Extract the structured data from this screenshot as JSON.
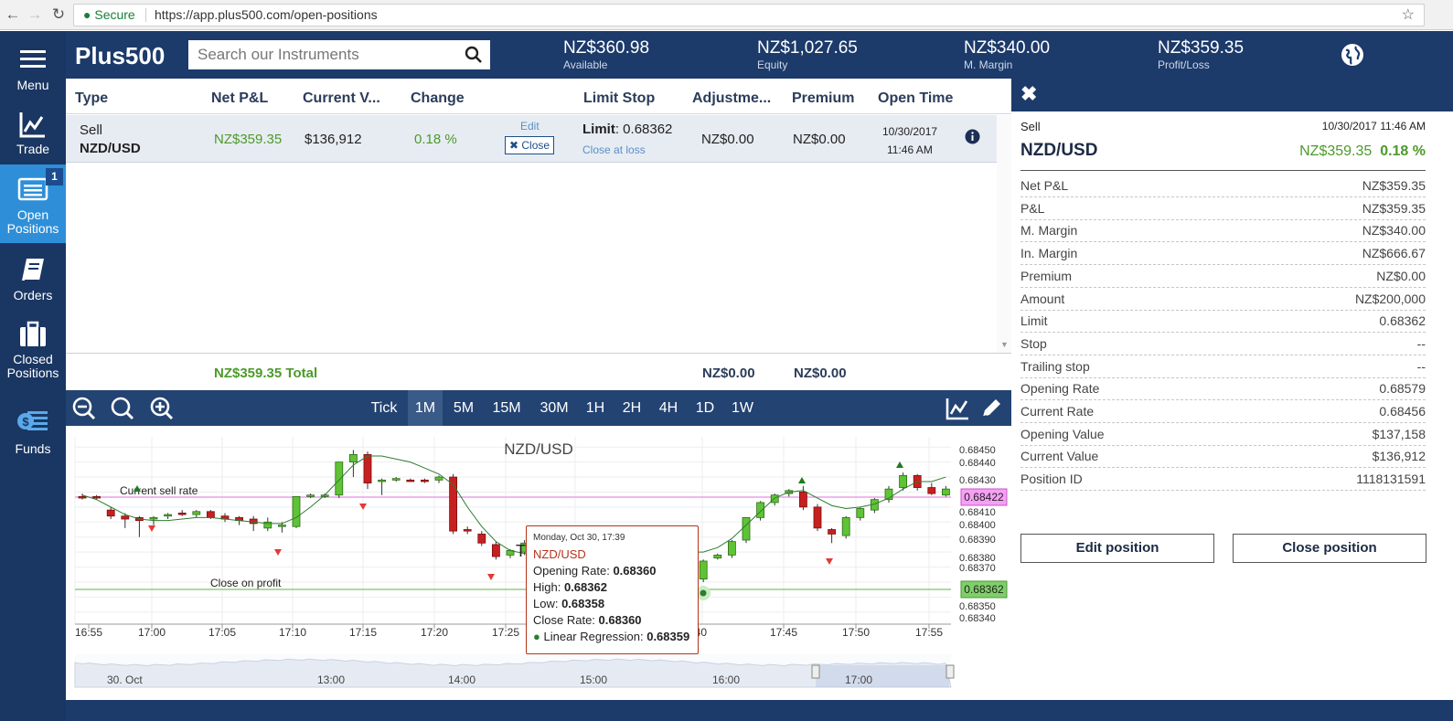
{
  "browser": {
    "secure_label": "Secure",
    "url": "https://app.plus500.com/open-positions"
  },
  "nav": {
    "menu": "Menu",
    "trade": "Trade",
    "open_positions": "Open\nPositions",
    "open_badge": "1",
    "orders": "Orders",
    "closed_positions": "Closed\nPositions",
    "funds": "Funds"
  },
  "header": {
    "logo": "Plus500",
    "search_placeholder": "Search our Instruments",
    "stats": [
      {
        "value": "NZ$360.98",
        "label": "Available"
      },
      {
        "value": "NZ$1,027.65",
        "label": "Equity"
      },
      {
        "value": "NZ$340.00",
        "label": "M. Margin"
      },
      {
        "value": "NZ$359.35",
        "label": "Profit/Loss"
      }
    ]
  },
  "table": {
    "columns": [
      "Type",
      "Net P&L",
      "Current V...",
      "Change",
      "Limit Stop",
      "Adjustme...",
      "Premium",
      "Open Time"
    ],
    "row": {
      "type": "Sell",
      "instrument": "NZD/USD",
      "net_pl": "NZ$359.35",
      "current_value": "$136,912",
      "change": "0.18 %",
      "edit": "Edit",
      "close": "Close",
      "limit_label": "Limit",
      "limit_value": ": 0.68362",
      "close_at_loss": "Close at loss",
      "adjustment": "NZ$0.00",
      "premium": "NZ$0.00",
      "open_date": "10/30/2017",
      "open_time": "11:46 AM"
    },
    "totals": {
      "net_pl": "NZ$359.35",
      "total_label": "Total",
      "adjustment": "NZ$0.00",
      "premium": "NZ$0.00"
    }
  },
  "chart_toolbar": {
    "timeframes": [
      "Tick",
      "1M",
      "5M",
      "15M",
      "30M",
      "1H",
      "2H",
      "4H",
      "1D",
      "1W"
    ],
    "selected": "1M"
  },
  "chart_data": {
    "type": "candlestick",
    "title": "NZD/USD",
    "x_ticks": [
      "16:55",
      "17:00",
      "17:05",
      "17:10",
      "17:15",
      "17:20",
      "17:25",
      "17:40",
      "17:45",
      "17:50",
      "17:55"
    ],
    "y_ticks": [
      "0.68450",
      "0.68440",
      "0.68430",
      "0.68410",
      "0.68400",
      "0.68390",
      "0.68380",
      "0.68370",
      "0.68350",
      "0.68340"
    ],
    "ylim": [
      0.68335,
      0.68455
    ],
    "annotations": {
      "current_sell_rate_label": "Current sell rate",
      "current_sell_rate": "0.68422",
      "close_on_profit_label": "Close on profit",
      "close_on_profit": "0.68362",
      "cursor_label": "T"
    },
    "series": [
      {
        "o": 0.68417,
        "h": 0.68419,
        "l": 0.68415,
        "c": 0.68416
      },
      {
        "o": 0.68417,
        "h": 0.68418,
        "l": 0.68415,
        "c": 0.68416
      },
      {
        "o": 0.68408,
        "h": 0.6841,
        "l": 0.68402,
        "c": 0.68404
      },
      {
        "o": 0.68404,
        "h": 0.68406,
        "l": 0.68396,
        "c": 0.68402
      },
      {
        "o": 0.68403,
        "h": 0.68404,
        "l": 0.6839,
        "c": 0.68401
      },
      {
        "o": 0.68402,
        "h": 0.68404,
        "l": 0.68398,
        "c": 0.68403
      },
      {
        "o": 0.68404,
        "h": 0.68406,
        "l": 0.68402,
        "c": 0.68405
      },
      {
        "o": 0.68406,
        "h": 0.68408,
        "l": 0.68404,
        "c": 0.68405
      },
      {
        "o": 0.68405,
        "h": 0.68408,
        "l": 0.68403,
        "c": 0.68407
      },
      {
        "o": 0.68407,
        "h": 0.68408,
        "l": 0.68402,
        "c": 0.68403
      },
      {
        "o": 0.68404,
        "h": 0.68406,
        "l": 0.684,
        "c": 0.68402
      },
      {
        "o": 0.68403,
        "h": 0.68404,
        "l": 0.68398,
        "c": 0.68401
      },
      {
        "o": 0.68402,
        "h": 0.68404,
        "l": 0.68394,
        "c": 0.68399
      },
      {
        "o": 0.68396,
        "h": 0.68403,
        "l": 0.68394,
        "c": 0.684
      },
      {
        "o": 0.68397,
        "h": 0.684,
        "l": 0.68393,
        "c": 0.68398
      },
      {
        "o": 0.68397,
        "h": 0.68417,
        "l": 0.68396,
        "c": 0.68417
      },
      {
        "o": 0.68417,
        "h": 0.68419,
        "l": 0.68416,
        "c": 0.68418
      },
      {
        "o": 0.68417,
        "h": 0.68419,
        "l": 0.68416,
        "c": 0.68418
      },
      {
        "o": 0.68418,
        "h": 0.6844,
        "l": 0.68416,
        "c": 0.6844
      },
      {
        "o": 0.6844,
        "h": 0.68448,
        "l": 0.6843,
        "c": 0.68445
      },
      {
        "o": 0.68445,
        "h": 0.68447,
        "l": 0.68422,
        "c": 0.68426
      },
      {
        "o": 0.68427,
        "h": 0.68429,
        "l": 0.68418,
        "c": 0.68428
      },
      {
        "o": 0.68428,
        "h": 0.6843,
        "l": 0.68427,
        "c": 0.68429
      },
      {
        "o": 0.68428,
        "h": 0.68429,
        "l": 0.68427,
        "c": 0.68427
      },
      {
        "o": 0.68428,
        "h": 0.68429,
        "l": 0.68426,
        "c": 0.68427
      },
      {
        "o": 0.68428,
        "h": 0.68431,
        "l": 0.68426,
        "c": 0.6843
      },
      {
        "o": 0.6843,
        "h": 0.68432,
        "l": 0.68392,
        "c": 0.68394
      },
      {
        "o": 0.68395,
        "h": 0.68397,
        "l": 0.68392,
        "c": 0.68394
      },
      {
        "o": 0.68392,
        "h": 0.68394,
        "l": 0.68384,
        "c": 0.68386
      },
      {
        "o": 0.68385,
        "h": 0.68387,
        "l": 0.68375,
        "c": 0.68377
      },
      {
        "o": 0.68378,
        "h": 0.68382,
        "l": 0.68376,
        "c": 0.68381
      },
      {
        "o": 0.6838,
        "h": 0.68388,
        "l": 0.68378,
        "c": 0.68386
      },
      {
        "o": 0.68362,
        "h": 0.68375,
        "l": 0.6836,
        "c": 0.68374
      },
      {
        "o": 0.68376,
        "h": 0.68379,
        "l": 0.68375,
        "c": 0.68378
      },
      {
        "o": 0.68378,
        "h": 0.68388,
        "l": 0.68376,
        "c": 0.68387
      },
      {
        "o": 0.68388,
        "h": 0.68403,
        "l": 0.68386,
        "c": 0.68403
      },
      {
        "o": 0.68403,
        "h": 0.68414,
        "l": 0.68401,
        "c": 0.68413
      },
      {
        "o": 0.68413,
        "h": 0.68419,
        "l": 0.68411,
        "c": 0.68418
      },
      {
        "o": 0.68419,
        "h": 0.68422,
        "l": 0.68417,
        "c": 0.68421
      },
      {
        "o": 0.6842,
        "h": 0.68424,
        "l": 0.68408,
        "c": 0.6841
      },
      {
        "o": 0.6841,
        "h": 0.68412,
        "l": 0.68394,
        "c": 0.68396
      },
      {
        "o": 0.68395,
        "h": 0.68396,
        "l": 0.68386,
        "c": 0.68392
      },
      {
        "o": 0.68391,
        "h": 0.68404,
        "l": 0.68389,
        "c": 0.68403
      },
      {
        "o": 0.68403,
        "h": 0.6841,
        "l": 0.68401,
        "c": 0.68409
      },
      {
        "o": 0.68408,
        "h": 0.68416,
        "l": 0.68406,
        "c": 0.68415
      },
      {
        "o": 0.68415,
        "h": 0.68424,
        "l": 0.68413,
        "c": 0.68422
      },
      {
        "o": 0.68423,
        "h": 0.68433,
        "l": 0.68421,
        "c": 0.68431
      },
      {
        "o": 0.68431,
        "h": 0.68432,
        "l": 0.68421,
        "c": 0.68423
      },
      {
        "o": 0.68423,
        "h": 0.68426,
        "l": 0.68418,
        "c": 0.68419
      },
      {
        "o": 0.68418,
        "h": 0.68424,
        "l": 0.68417,
        "c": 0.68422
      }
    ],
    "linear_regression": [
      0.68418,
      0.68415,
      0.6841,
      0.68405,
      0.68402,
      0.68401,
      0.68401,
      0.68402,
      0.68403,
      0.68403,
      0.68402,
      0.68401,
      0.684,
      0.68399,
      0.68399,
      0.68403,
      0.6841,
      0.68418,
      0.68428,
      0.68438,
      0.68444,
      0.68444,
      0.68442,
      0.6844,
      0.68436,
      0.68432,
      0.68425,
      0.6841,
      0.68397,
      0.68387,
      0.68381,
      0.68379,
      0.6838,
      0.68383,
      0.68389,
      0.68398,
      0.68407,
      0.68416,
      0.6842,
      0.68421,
      0.68416,
      0.68411,
      0.68409,
      0.6841,
      0.68412,
      0.68416,
      0.68422,
      0.68427,
      0.68427,
      0.6843
    ]
  },
  "tooltip": {
    "date": "Monday, Oct 30, 17:39",
    "instrument": "NZD/USD",
    "open_label": "Opening Rate: ",
    "open": "0.68360",
    "high_label": "High: ",
    "high": "0.68362",
    "low_label": "Low: ",
    "low": "0.68358",
    "close_label": "Close Rate: ",
    "close": "0.68360",
    "lr_label": "Linear Regression: ",
    "lr": "0.68359"
  },
  "navigator": {
    "labels": [
      "30. Oct",
      "13:00",
      "14:00",
      "15:00",
      "16:00",
      "17:00"
    ]
  },
  "detail": {
    "type": "Sell",
    "datetime": "10/30/2017 11:46 AM",
    "instrument": "NZD/USD",
    "pl": "NZ$359.35",
    "change": "0.18 %",
    "rows": [
      {
        "k": "Net P&L",
        "v": "NZ$359.35"
      },
      {
        "k": "P&L",
        "v": "NZ$359.35"
      },
      {
        "k": "M. Margin",
        "v": "NZ$340.00"
      },
      {
        "k": "In. Margin",
        "v": "NZ$666.67"
      },
      {
        "k": "Premium",
        "v": "NZ$0.00"
      },
      {
        "k": "Amount",
        "v": "NZ$200,000"
      },
      {
        "k": "Limit",
        "v": "0.68362"
      },
      {
        "k": "Stop",
        "v": "--"
      },
      {
        "k": "Trailing stop",
        "v": "--"
      },
      {
        "k": "Opening Rate",
        "v": "0.68579"
      },
      {
        "k": "Current Rate",
        "v": "0.68456"
      },
      {
        "k": "Opening Value",
        "v": "$137,158"
      },
      {
        "k": "Current Value",
        "v": "$136,912"
      },
      {
        "k": "Position ID",
        "v": "1118131591"
      }
    ],
    "edit_button": "Edit position",
    "close_button": "Close position"
  }
}
